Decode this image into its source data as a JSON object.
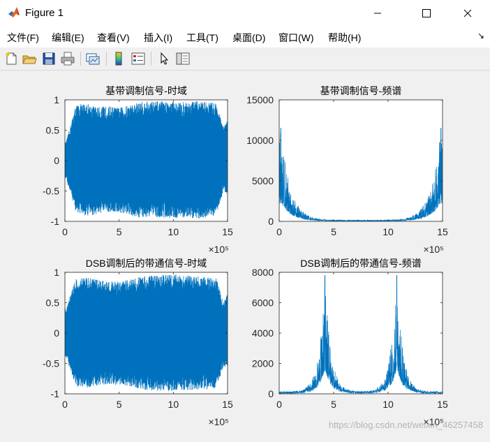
{
  "window": {
    "title": "Figure 1"
  },
  "menu": [
    "文件(F)",
    "编辑(E)",
    "查看(V)",
    "插入(I)",
    "工具(T)",
    "桌面(D)",
    "窗口(W)",
    "帮助(H)"
  ],
  "toolbar": [
    "new-figure-icon",
    "open-file-icon",
    "save-icon",
    "print-icon",
    "link-plot-icon",
    "colorbar-icon",
    "legend-icon",
    "pointer-icon",
    "property-editor-icon"
  ],
  "colors": {
    "series": "#0072bd",
    "axes": "#262626"
  },
  "watermark": "https://blog.csdn.net/weixin_46257458",
  "chart_data": [
    {
      "type": "area",
      "title": "基带调制信号-时域",
      "xlim": [
        0,
        15
      ],
      "ylim": [
        -1,
        1
      ],
      "xticks": [
        0,
        5,
        10,
        15
      ],
      "yticks": [
        -1,
        -0.5,
        0,
        0.5,
        1
      ],
      "xticklabels": [
        "0",
        "5",
        "10",
        "15"
      ],
      "yticklabels": [
        "-1",
        "-0.5",
        "0",
        "0.5",
        "1"
      ],
      "xexponent": "×10⁵",
      "x": [
        0.1,
        1,
        2,
        3,
        4,
        5,
        6,
        7,
        8,
        9,
        10,
        11,
        12,
        13,
        14,
        14.6,
        15
      ],
      "max": [
        0.3,
        0.92,
        0.95,
        0.88,
        0.9,
        0.87,
        0.92,
        0.97,
        0.98,
        0.98,
        0.97,
        0.96,
        0.98,
        0.97,
        0.95,
        0.55,
        0.7
      ],
      "min": [
        -0.3,
        -0.85,
        -0.92,
        -0.88,
        -0.85,
        -0.86,
        -0.92,
        -0.94,
        -0.92,
        -0.94,
        -0.95,
        -0.94,
        -0.96,
        -0.94,
        -0.9,
        -0.5,
        -0.55
      ]
    },
    {
      "type": "line",
      "title": "基带调制信号-频谱",
      "xlim": [
        0,
        15
      ],
      "ylim": [
        0,
        15000
      ],
      "xticks": [
        0,
        5,
        10,
        15
      ],
      "yticks": [
        0,
        5000,
        10000,
        15000
      ],
      "xticklabels": [
        "0",
        "5",
        "10",
        "15"
      ],
      "yticklabels": [
        "0",
        "5000",
        "10000",
        "15000"
      ],
      "xexponent": "×10⁵",
      "peaks": [
        {
          "x": 0.15,
          "y": 11500
        },
        {
          "x": 14.85,
          "y": 11500
        }
      ],
      "decay": 0.9,
      "floor": 150
    },
    {
      "type": "area",
      "title": "DSB调制后的带通信号-时域",
      "xlim": [
        0,
        15
      ],
      "ylim": [
        -1,
        1
      ],
      "xticks": [
        0,
        5,
        10,
        15
      ],
      "yticks": [
        -1,
        -0.5,
        0,
        0.5,
        1
      ],
      "xticklabels": [
        "0",
        "5",
        "10",
        "15"
      ],
      "yticklabels": [
        "-1",
        "-0.5",
        "0",
        "0.5",
        "1"
      ],
      "xexponent": "×10⁵",
      "x": [
        0.1,
        1,
        2,
        3,
        4,
        5,
        6,
        7,
        8,
        9,
        10,
        11,
        12,
        13,
        14,
        14.6,
        15
      ],
      "max": [
        0.4,
        0.9,
        0.92,
        0.88,
        0.85,
        0.86,
        0.88,
        0.93,
        0.95,
        0.96,
        0.97,
        0.95,
        0.94,
        0.92,
        0.9,
        0.5,
        0.65
      ],
      "min": [
        -0.4,
        -0.88,
        -0.9,
        -0.87,
        -0.85,
        -0.86,
        -0.88,
        -0.92,
        -0.95,
        -0.95,
        -0.96,
        -0.94,
        -0.94,
        -0.93,
        -0.9,
        -0.55,
        -0.6
      ]
    },
    {
      "type": "line",
      "title": "DSB调制后的带通信号-频谱",
      "xlim": [
        0,
        15
      ],
      "ylim": [
        0,
        8000
      ],
      "xticks": [
        0,
        5,
        10,
        15
      ],
      "yticks": [
        0,
        2000,
        4000,
        6000,
        8000
      ],
      "xticklabels": [
        "0",
        "5",
        "10",
        "15"
      ],
      "yticklabels": [
        "0",
        "2000",
        "4000",
        "6000",
        "8000"
      ],
      "xexponent": "×10⁵",
      "peaks": [
        {
          "x": 4.2,
          "y": 7800
        },
        {
          "x": 10.8,
          "y": 7800
        }
      ],
      "decay": 0.55,
      "floor": 150
    }
  ]
}
